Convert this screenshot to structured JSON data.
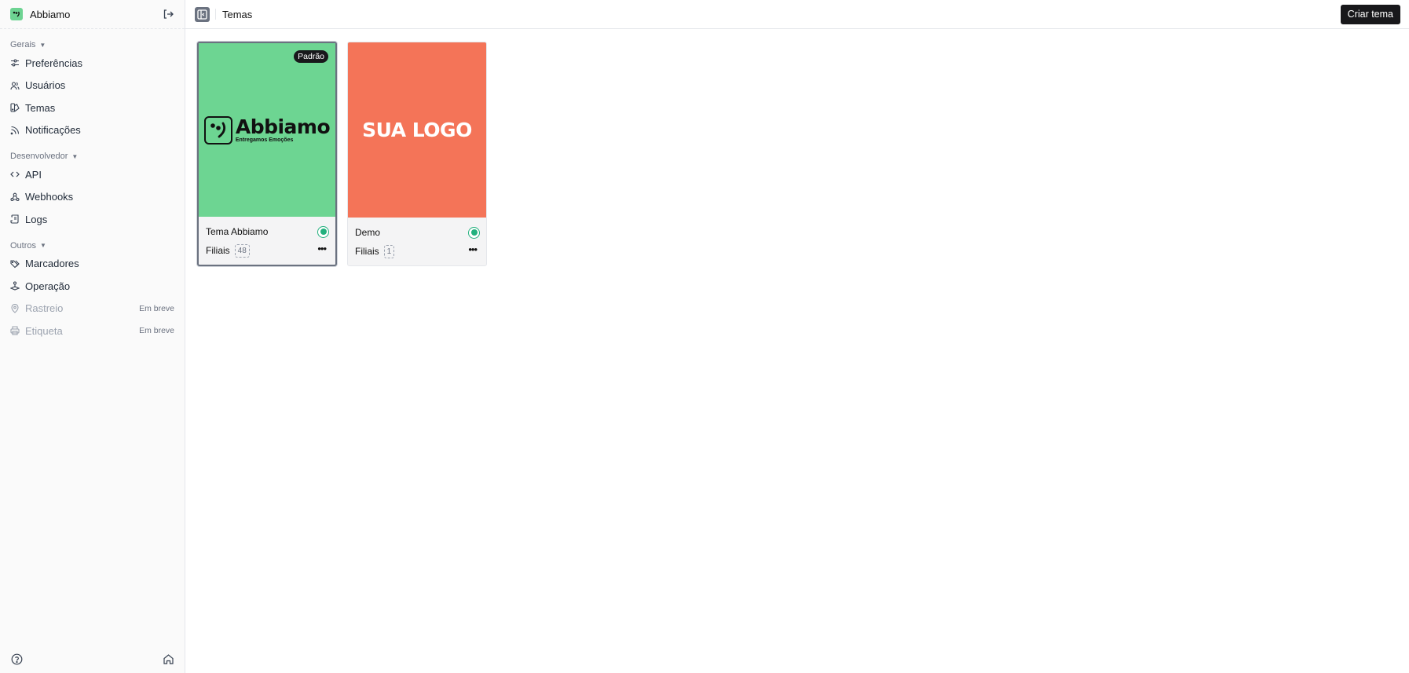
{
  "sidebar": {
    "brand": "Abbiamo",
    "groups": [
      {
        "title": "Gerais",
        "items": [
          {
            "label": "Preferências",
            "icon": "sliders-icon"
          },
          {
            "label": "Usuários",
            "icon": "users-icon"
          },
          {
            "label": "Temas",
            "icon": "palette-icon"
          },
          {
            "label": "Notificações",
            "icon": "rss-icon"
          }
        ]
      },
      {
        "title": "Desenvolvedor",
        "items": [
          {
            "label": "API",
            "icon": "code-icon"
          },
          {
            "label": "Webhooks",
            "icon": "webhook-icon"
          },
          {
            "label": "Logs",
            "icon": "scroll-icon"
          }
        ]
      },
      {
        "title": "Outros",
        "items": [
          {
            "label": "Marcadores",
            "icon": "tags-icon"
          },
          {
            "label": "Operação",
            "icon": "joystick-icon"
          },
          {
            "label": "Rastreio",
            "icon": "map-pin-icon",
            "soon": "Em breve"
          },
          {
            "label": "Etiqueta",
            "icon": "printer-icon",
            "soon": "Em breve"
          }
        ]
      }
    ]
  },
  "topbar": {
    "title": "Temas",
    "create_label": "Criar tema"
  },
  "themes": [
    {
      "name": "Tema Abbiamo",
      "badge": "Padrão",
      "filiais_label": "Filiais",
      "filiais_count": "48",
      "color": "#6dd592",
      "logo_title": "Abbiamo",
      "logo_subtitle": "Entregamos Emoções"
    },
    {
      "name": "Demo",
      "filiais_label": "Filiais",
      "filiais_count": "1",
      "color": "#f47458",
      "logo_text": "SUA LOGO"
    }
  ],
  "colors": {
    "accent": "#22b07d",
    "brand_green": "#6dd592",
    "demo_red": "#f47458",
    "button_dark": "#18181b"
  }
}
